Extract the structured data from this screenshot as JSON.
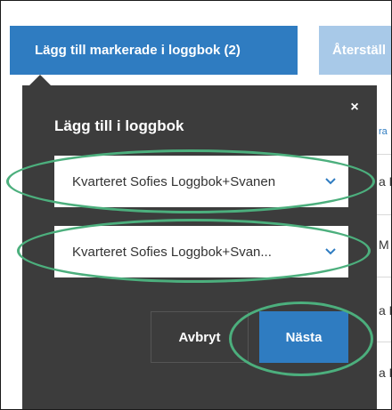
{
  "toolbar": {
    "add_selected_label": "Lägg till markerade i loggbok (2)",
    "restore_label": "Återställ"
  },
  "background_table": {
    "header_fragment": "ra",
    "row_fragments": [
      "a M",
      "M",
      "a M",
      "a M"
    ]
  },
  "dialog": {
    "title": "Lägg till i loggbok",
    "close_label": "×",
    "selects": [
      {
        "value": "Kvarteret Sofies Loggbok+Svanen"
      },
      {
        "value": "Kvarteret Sofies Loggbok+Svan..."
      }
    ],
    "cancel_label": "Avbryt",
    "next_label": "Nästa"
  },
  "colors": {
    "primary": "#2f7cc1",
    "dialog_bg": "#3c3c3c",
    "annotation": "#4caf7d"
  }
}
